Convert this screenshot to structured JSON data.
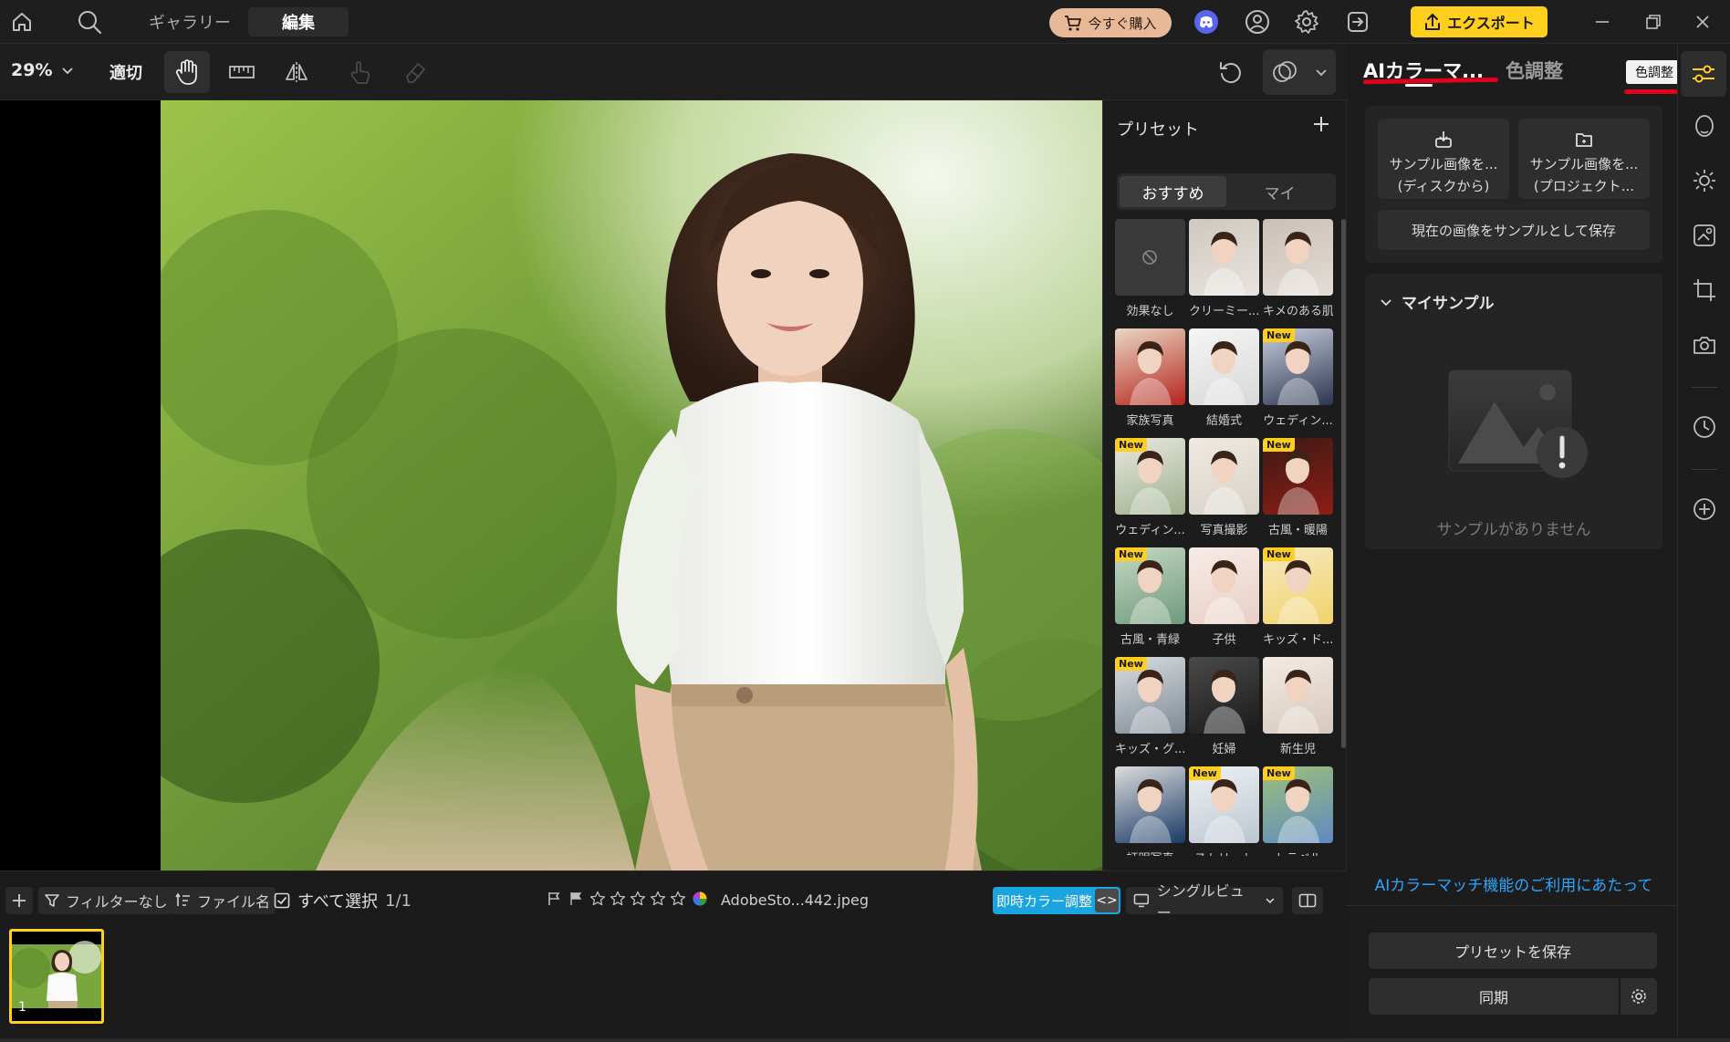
{
  "topbar": {
    "tabs": [
      {
        "label": "ギャラリー"
      },
      {
        "label": "編集"
      }
    ],
    "buy_label": "今すぐ購入",
    "export_label": "エクスポート",
    "accent_color": "#ffcf1c",
    "buy_color": "#e8b997"
  },
  "toolbar": {
    "zoom": "29%",
    "fit_label": "適切"
  },
  "presets": {
    "title": "プリセット",
    "tabs": [
      "おすすめ",
      "マイ"
    ],
    "new_badge": "New",
    "items": [
      {
        "label": "効果なし",
        "new": false
      },
      {
        "label": "クリーミー...",
        "new": false
      },
      {
        "label": "キメのある肌",
        "new": false
      },
      {
        "label": "家族写真",
        "new": false
      },
      {
        "label": "結婚式",
        "new": false
      },
      {
        "label": "ウェディン...",
        "new": true
      },
      {
        "label": "ウェディン...",
        "new": true
      },
      {
        "label": "写真撮影",
        "new": false
      },
      {
        "label": "古風・暖陽",
        "new": true
      },
      {
        "label": "古風・青緑",
        "new": true
      },
      {
        "label": "子供",
        "new": false
      },
      {
        "label": "キッズ・ド...",
        "new": true
      },
      {
        "label": "キッズ・グ...",
        "new": true
      },
      {
        "label": "妊婦",
        "new": false
      },
      {
        "label": "新生児",
        "new": false
      },
      {
        "label": "証明写真",
        "new": false
      },
      {
        "label": "ストリート",
        "new": true
      },
      {
        "label": "トラベル",
        "new": true
      }
    ]
  },
  "right_panel": {
    "tab_ai": "AIカラーマ...",
    "tab_color": "色調整",
    "color_badge": "色調整",
    "sample_disk_line1": "サンプル画像を...",
    "sample_disk_line2": "(ディスクから)",
    "sample_proj_line1": "サンプル画像を...",
    "sample_proj_line2": "(プロジェクト...",
    "save_current": "現在の画像をサンプルとして保存",
    "my_samples": "マイサンプル",
    "no_samples": "サンプルがありません",
    "ai_link": "AIカラーマッチ機能のご利用にあたって",
    "save_preset": "プリセットを保存",
    "sync": "同期",
    "link_color": "#2aa6ff"
  },
  "bottombar": {
    "filter": "フィルターなし",
    "sort": "ファイル名",
    "select_all": "すべて選択",
    "count": "1/1",
    "filename": "AdobeSto...442.jpeg",
    "instant_color": "即時カラー調整",
    "view": "シングルビュー",
    "thumb_index": "1",
    "rating": 0,
    "rating_max": 5
  }
}
